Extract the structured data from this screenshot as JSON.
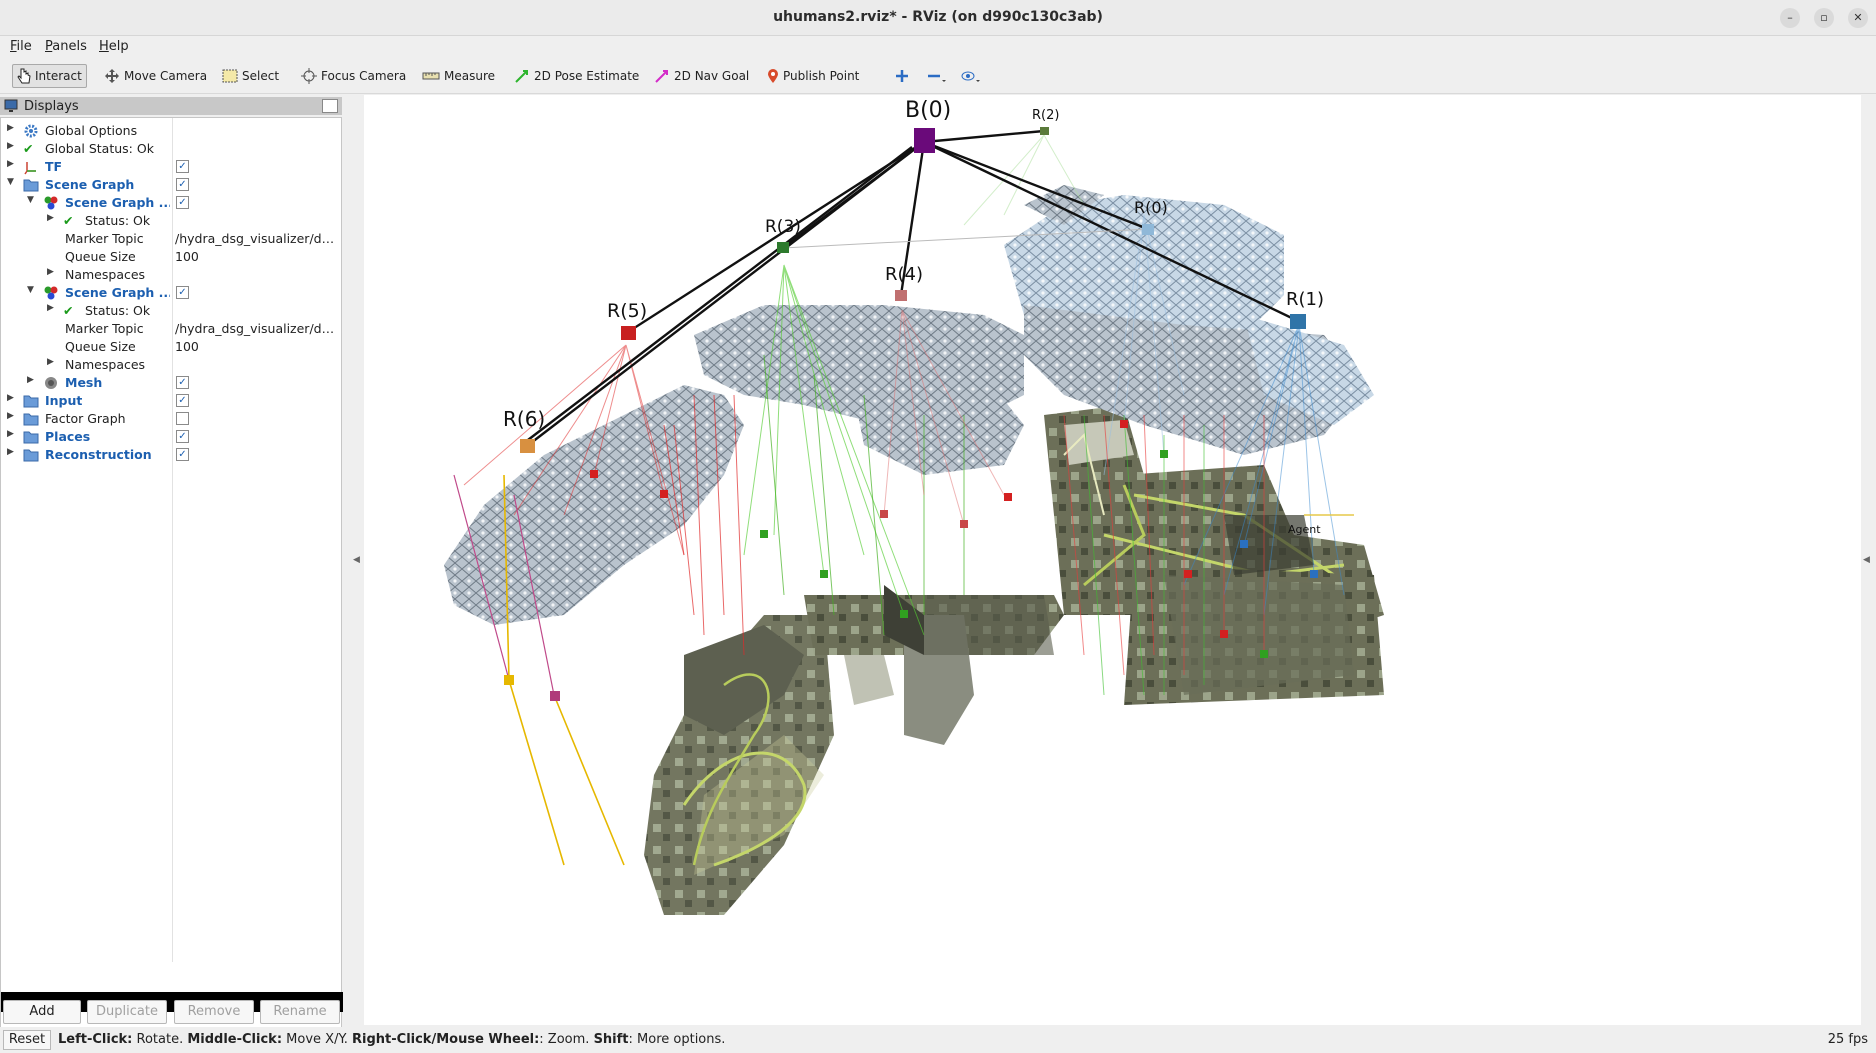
{
  "window": {
    "title": "uhumans2.rviz* - RViz (on d990c130c3ab)",
    "controls": [
      "–",
      "▫",
      "✕"
    ]
  },
  "menu": [
    "File",
    "Panels",
    "Help"
  ],
  "toolbar": {
    "tools": [
      "Interact",
      "Move Camera",
      "Select",
      "Focus Camera",
      "Measure",
      "2D Pose Estimate",
      "2D Nav Goal",
      "Publish Point"
    ],
    "active_tool": "Interact"
  },
  "displays": {
    "title": "Displays",
    "rows": [
      {
        "label": "Global Options",
        "value": "",
        "expanded": false
      },
      {
        "label": "Global Status: Ok",
        "value": "",
        "expanded": false
      },
      {
        "label": "TF",
        "checked": true
      },
      {
        "label": "Scene Graph",
        "checked": true
      },
      {
        "label": "Scene Graph ...",
        "checked": true
      },
      {
        "label": "Status: Ok"
      },
      {
        "label": "Marker Topic",
        "value": "/hydra_dsg_visualizer/ds..."
      },
      {
        "label": "Queue Size",
        "value": "100"
      },
      {
        "label": "Namespaces"
      },
      {
        "label": "Scene Graph ...",
        "checked": true
      },
      {
        "label": "Status: Ok"
      },
      {
        "label": "Marker Topic",
        "value": "/hydra_dsg_visualizer/dy..."
      },
      {
        "label": "Queue Size",
        "value": "100"
      },
      {
        "label": "Namespaces"
      },
      {
        "label": "Mesh",
        "checked": true
      },
      {
        "label": "Input",
        "checked": true
      },
      {
        "label": "Factor Graph",
        "checked": false
      },
      {
        "label": "Places",
        "checked": true
      },
      {
        "label": "Reconstruction",
        "checked": true
      }
    ],
    "buttons": {
      "add": "Add",
      "duplicate": "Duplicate",
      "remove": "Remove",
      "rename": "Rename"
    }
  },
  "scene": {
    "labels": {
      "building": "B(0)",
      "rooms": [
        "R(0)",
        "R(1)",
        "R(2)",
        "R(3)",
        "R(4)",
        "R(5)",
        "R(6)"
      ],
      "agent": "Agent"
    },
    "colors": {
      "building": "#6a0a7a",
      "room0": "#8fb8d8",
      "room1": "#2f74a8",
      "room2": "#5a7a3a",
      "room3": "#2d7a2d",
      "room4": "#c07070",
      "room5": "#c82020",
      "room6": "#d89040",
      "mesh": "#a8b4c0"
    }
  },
  "status": {
    "reset": "Reset",
    "hint_parts": [
      {
        "text": "Left-Click:",
        "bold": true
      },
      {
        "text": " Rotate. ",
        "bold": false
      },
      {
        "text": "Middle-Click:",
        "bold": true
      },
      {
        "text": " Move X/Y. ",
        "bold": false
      },
      {
        "text": "Right-Click/Mouse Wheel:",
        "bold": true
      },
      {
        "text": ": Zoom. ",
        "bold": false
      },
      {
        "text": "Shift",
        "bold": true
      },
      {
        "text": ": More options.",
        "bold": false
      }
    ],
    "fps": "25 fps"
  }
}
